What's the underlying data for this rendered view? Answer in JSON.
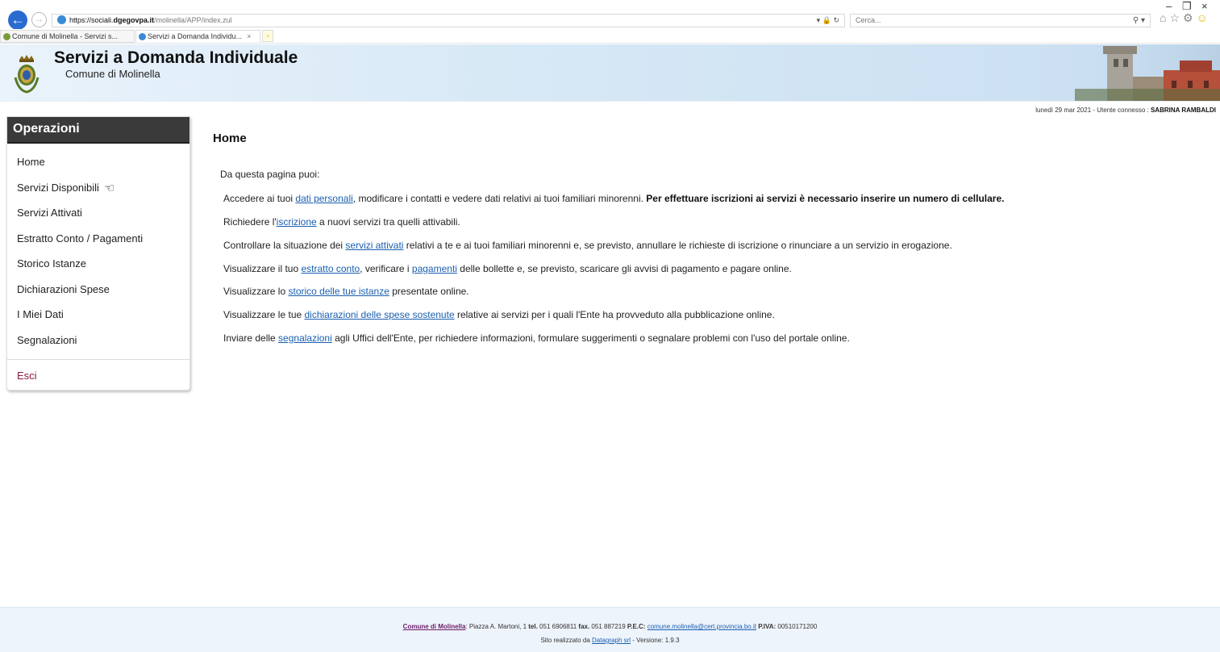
{
  "browser": {
    "url_protocol": "https://",
    "url_domain_pre": "sociali.",
    "url_domain": "dgegovpa.it",
    "url_path": "/molinella/APP/index.zul",
    "search_placeholder": "Cerca...",
    "tabs": [
      {
        "label": "Comune di Molinella - Servizi s..."
      },
      {
        "label": "Servizi a Domanda Individu...",
        "close": "×"
      }
    ],
    "window_controls": {
      "minimize": "–",
      "restore": "❐",
      "close": "×"
    }
  },
  "site": {
    "title": "Servizi a Domanda Individuale",
    "subtitle": "Comune di Molinella",
    "date": "lunedì 29 mar 2021",
    "user_label": "Utente connesso :",
    "user_name": "SABRINA RAMBALDI"
  },
  "sidebar": {
    "heading": "Operazioni",
    "items": [
      {
        "label": "Home"
      },
      {
        "label": "Servizi Disponibili"
      },
      {
        "label": "Servizi Attivati"
      },
      {
        "label": "Estratto Conto / Pagamenti"
      },
      {
        "label": "Storico Istanze"
      },
      {
        "label": "Dichiarazioni Spese"
      },
      {
        "label": "I Miei Dati"
      },
      {
        "label": "Segnalazioni"
      }
    ],
    "logout": "Esci"
  },
  "main": {
    "title": "Home",
    "intro": "Da questa pagina puoi:",
    "l1": {
      "a": "Accedere ai tuoi ",
      "link": "dati personali",
      "b": ", modificare i contatti e vedere dati relativi ai tuoi familiari minorenni. ",
      "bold": "Per effettuare iscrizioni ai servizi è necessario inserire un numero di cellulare."
    },
    "l2": {
      "a": "Richiedere l'",
      "link": "iscrizione",
      "b": " a nuovi servizi tra quelli attivabili."
    },
    "l3": {
      "a": "Controllare la situazione dei ",
      "link": "servizi attivati",
      "b": " relativi a te e ai tuoi familiari minorenni e, se previsto, annullare le richieste di iscrizione o rinunciare a un servizio in erogazione."
    },
    "l4": {
      "a": "Visualizzare il tuo ",
      "link": "estratto conto",
      "b": ", verificare i ",
      "link2": "pagamenti",
      "c": " delle bollette e, se previsto, scaricare gli avvisi di pagamento e pagare online."
    },
    "l5": {
      "a": "Visualizzare lo ",
      "link": "storico delle tue istanze",
      "b": " presentate online."
    },
    "l6": {
      "a": "Visualizzare le tue ",
      "link": "dichiarazioni delle spese sostenute",
      "b": " relative ai servizi per i quali l'Ente ha provveduto alla pubblicazione online."
    },
    "l7": {
      "a": "Inviare delle ",
      "link": "segnalazioni",
      "b": " agli Uffici dell'Ente, per richiedere informazioni, formulare suggerimenti o segnalare problemi con l'uso del portale online."
    }
  },
  "footer": {
    "comune_link": "Comune di Molinella",
    "address": ": Piazza A. Martoni, 1 ",
    "tel_label": "tel.",
    "tel": " 051 6906811 ",
    "fax_label": "fax.",
    "fax": " 051 887219 ",
    "pec_label": "P.E.C:",
    "pec": "comune.molinella@cert.provincia.bo.it",
    "piva_label": "P.IVA:",
    "piva": " 00510171200",
    "credit_a": "Sito realizzato da ",
    "credit_link": "Datagraph srl",
    "credit_b": " - Versione: 1.9.3"
  }
}
